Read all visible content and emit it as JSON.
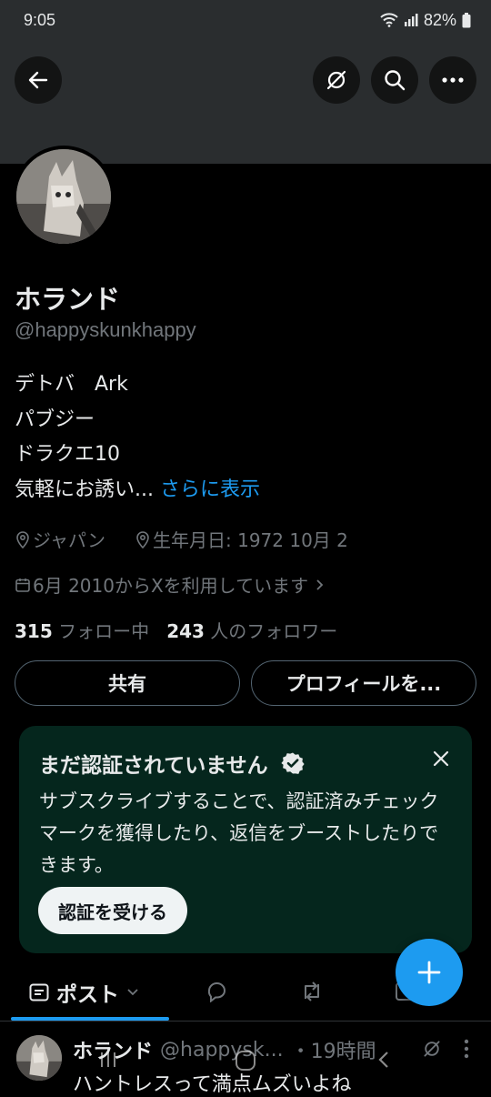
{
  "status_bar": {
    "time": "9:05",
    "battery": "82%"
  },
  "profile": {
    "name": "ホランド",
    "handle": "@happyskunkhappy",
    "bio_lines": [
      "デトバ　Ark",
      "パブジー",
      "ドラクエ10",
      "気軽にお誘い..."
    ],
    "bio_more": "さらに表示",
    "location": "ジャパン",
    "birthday": "生年月日: 1972 10月 2",
    "joined": "6月 2010からXを利用しています",
    "following_count": "315",
    "following_label": "フォロー中",
    "followers_count": "243",
    "followers_label": "人のフォロワー"
  },
  "buttons": {
    "share": "共有",
    "edit_profile": "プロフィールを..."
  },
  "verify_card": {
    "title": "まだ認証されていません",
    "body": "サブスクライブすることで、認証済みチェックマークを獲得したり、返信をブーストしたりできます。",
    "button": "認証を受ける"
  },
  "tabs": {
    "posts": "ポスト"
  },
  "post": {
    "name": "ホランド",
    "handle": "@happysk...",
    "time": "・19時間",
    "text": "ハントレスって満点ムズいよね"
  },
  "colors": {
    "accent": "#1d9bf0",
    "background": "#000000",
    "card": "#05261d"
  }
}
